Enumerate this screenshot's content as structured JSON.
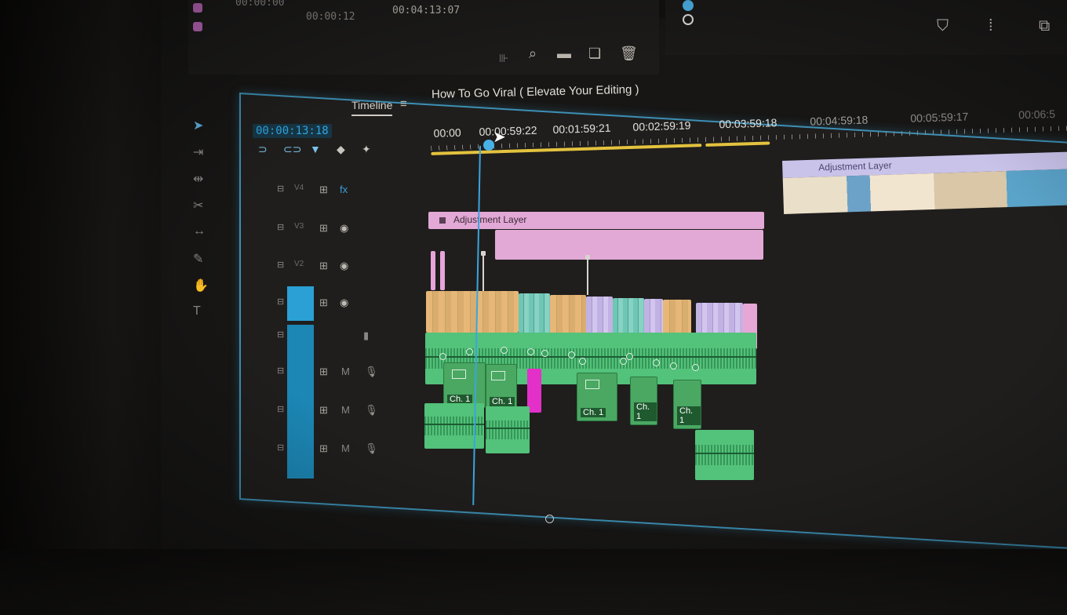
{
  "top_panel": {
    "timecodes": [
      "00:00:00",
      "00:00:12",
      "00:04:13:07"
    ],
    "swatch_color": "#c36bc0",
    "tools": [
      "film-icon",
      "search-icon",
      "folder-icon",
      "new-item-icon",
      "trash-icon"
    ]
  },
  "program_monitor": {
    "icons": [
      "shield-icon",
      "eyedropper-icon",
      "export-frame-icon"
    ],
    "playhead_color": "#4cb2e8"
  },
  "tabs": {
    "inactive_label": "",
    "active_label": "Timeline",
    "menu_icon": "≡"
  },
  "sequence": {
    "title": "How To Go Viral ( Elevate Your Editing )",
    "current_timecode": "00:00:13:18"
  },
  "ruler": {
    "labels": [
      "00:00",
      "00:00:59:22",
      "00:01:59:21",
      "00:02:59:19",
      "00:03:59:18",
      "00:04:59:18",
      "00:05:59:17",
      "00:06:5"
    ],
    "work_area_color": "#e3c23e"
  },
  "tracks": {
    "video_rows": 4,
    "audio_rows": 5,
    "lock_icon": "lock-icon",
    "eye_icon": "eye-icon",
    "mic_icon": "microphone-icon",
    "patch_color": "#1c86b4"
  },
  "clips": {
    "adjustment_label": "Adjustment Layer",
    "adjustment_label_far": "Adjustment Layer",
    "channel_label": "Ch. 1",
    "colors": {
      "adjustment": "#e2a8d6",
      "video": "#e6b777",
      "audio": "#53c27a",
      "magenta": "#e230c8",
      "playhead": "#3aa5df"
    }
  }
}
